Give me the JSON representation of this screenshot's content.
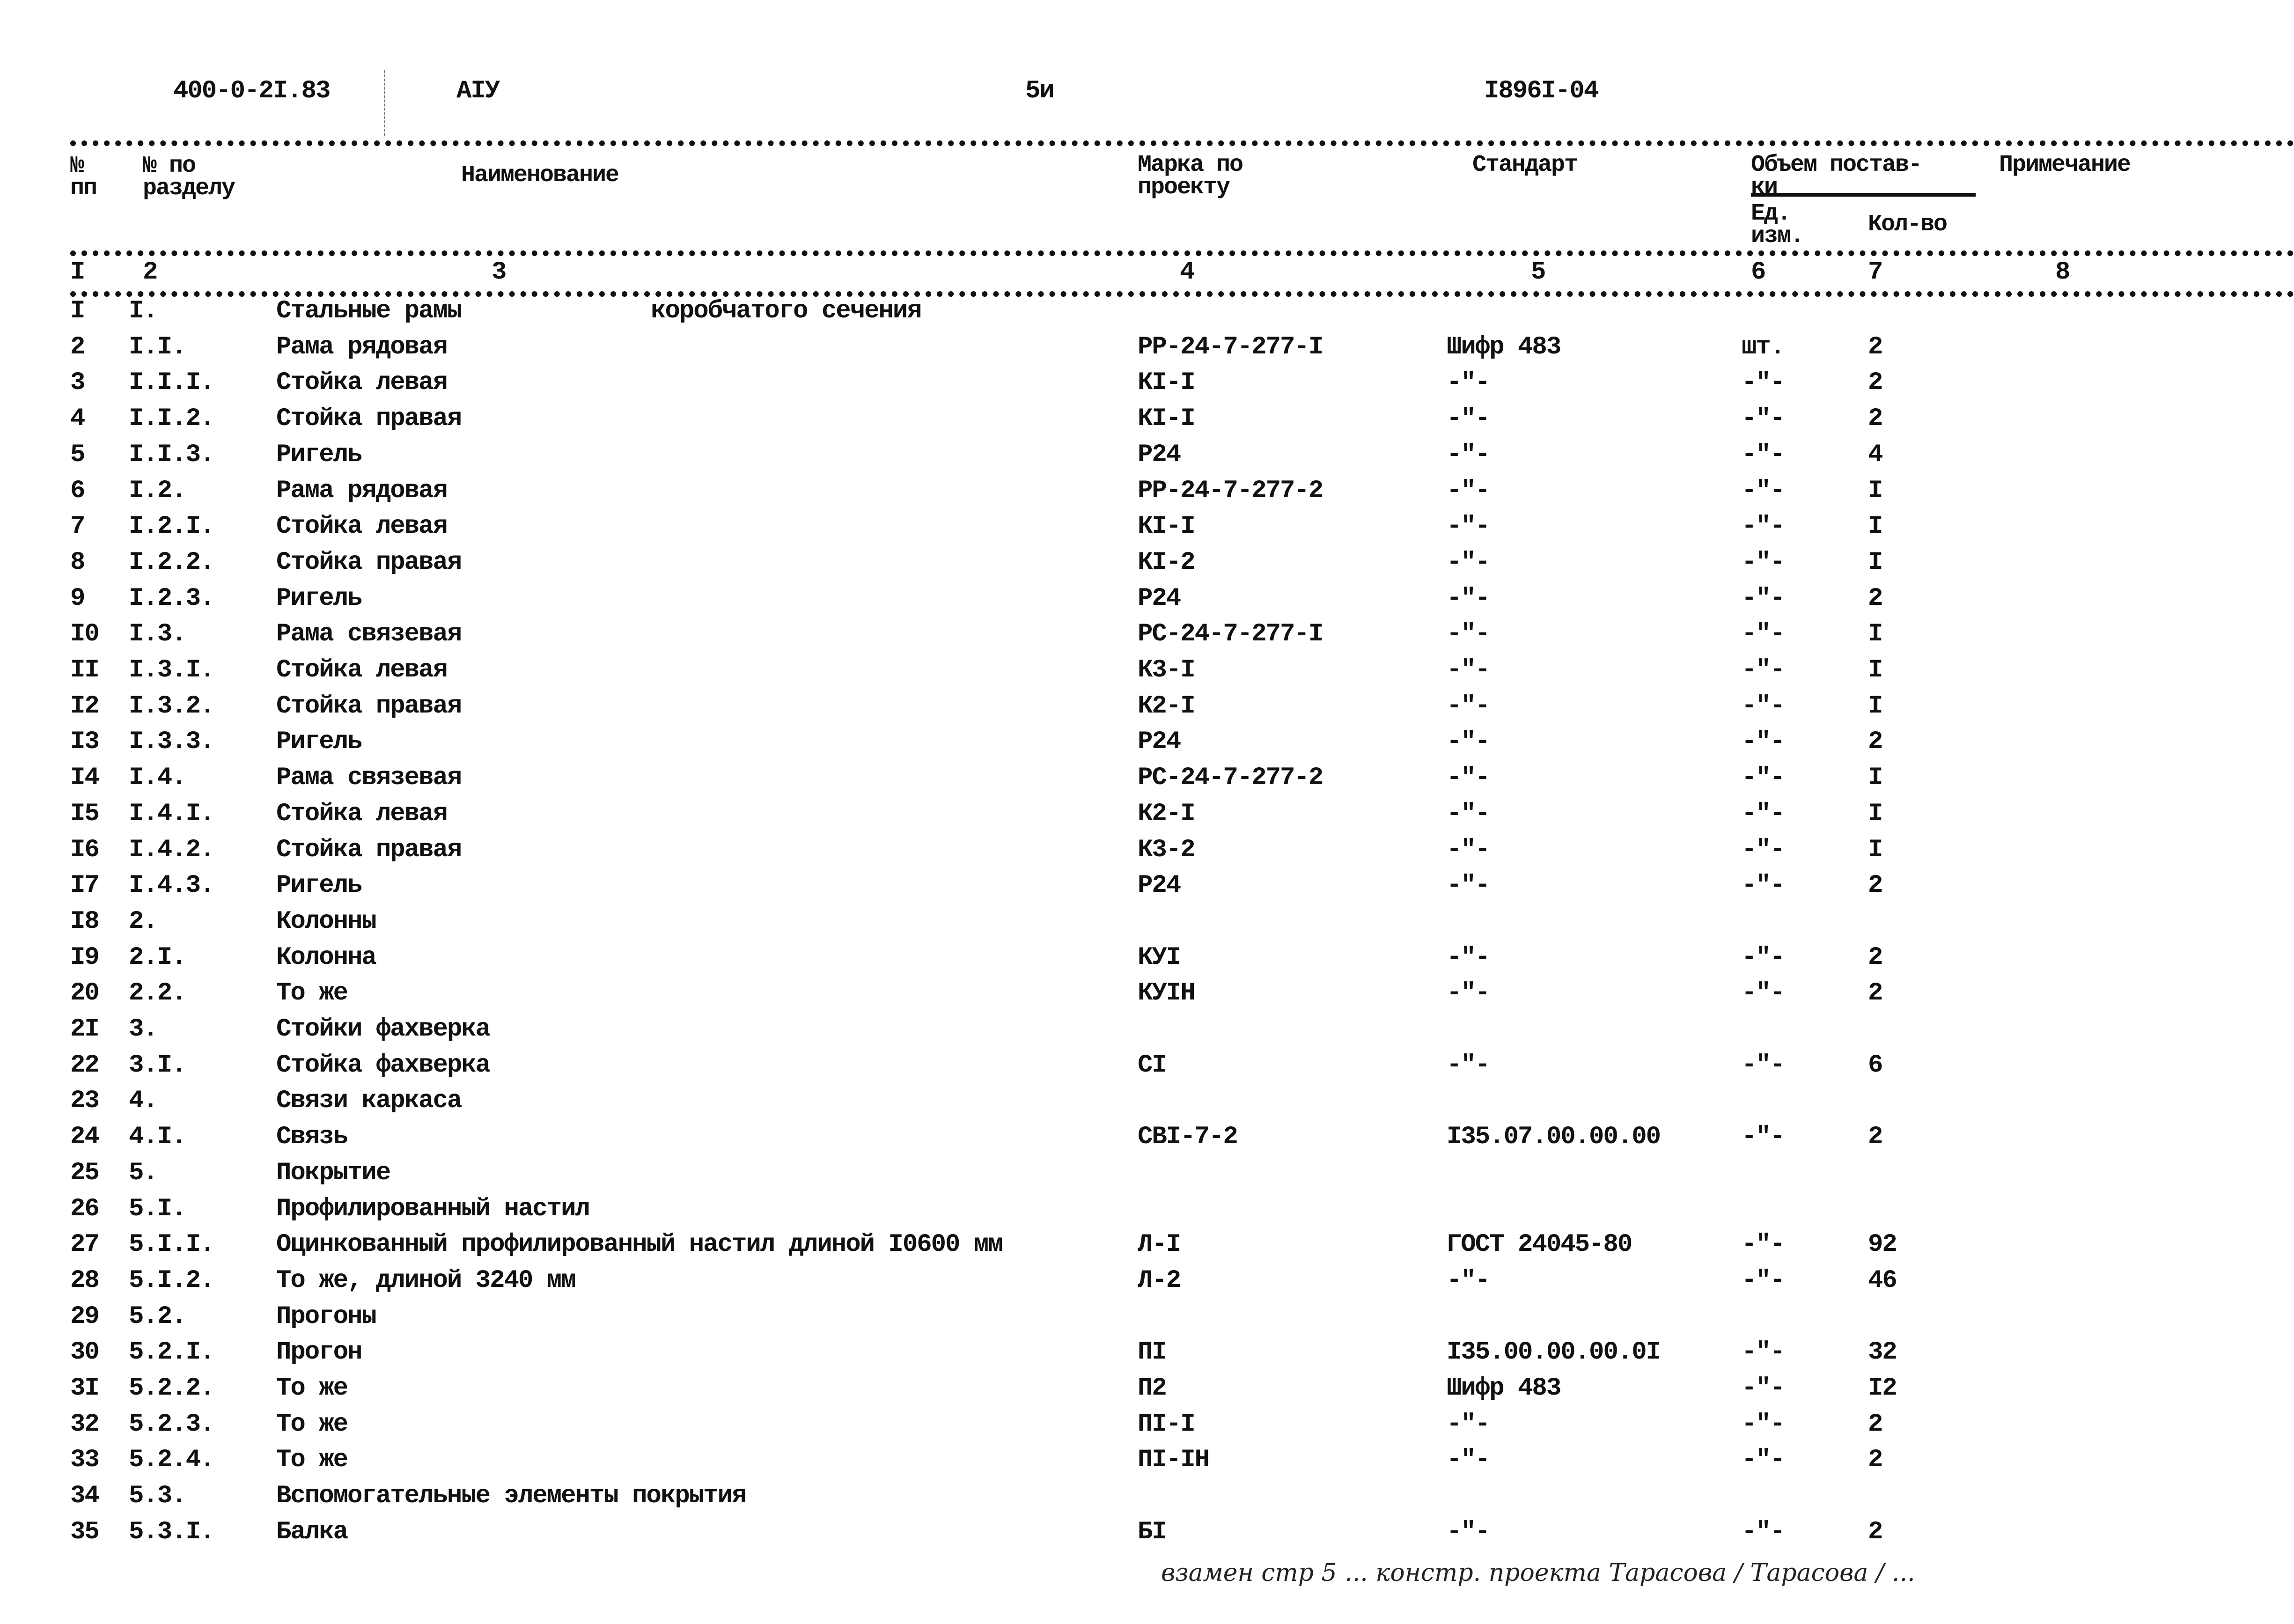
{
  "page_header": {
    "doc_code": "400-0-2I.83",
    "album": "AIУ",
    "page": "5и",
    "sheet_code": "I896I-04"
  },
  "table_header": {
    "col1": [
      "№",
      "пп"
    ],
    "col2": [
      "№ по",
      "разделу"
    ],
    "col3": "Наименование",
    "col4": [
      "Марка по",
      "проекту"
    ],
    "col5": "Стандарт",
    "col67_group": [
      "Объем постав-",
      "ки"
    ],
    "col6": [
      "Ед.",
      "изм."
    ],
    "col7": "Кол-во",
    "col8": "Примечание",
    "col_numbers": [
      "I",
      "2",
      "3",
      "4",
      "5",
      "6",
      "7",
      "8"
    ]
  },
  "rows": [
    {
      "n": "I",
      "sec": "I.",
      "name": "Стальные рамы",
      "name_extra": "коробчатого сечения",
      "mark": "",
      "std": "",
      "unit": "",
      "qty": ""
    },
    {
      "n": "2",
      "sec": "I.I.",
      "name": "Рама рядовая",
      "mark": "РР-24-7-277-I",
      "std": "Шифр 483",
      "unit": "шт.",
      "qty": "2"
    },
    {
      "n": "3",
      "sec": "I.I.I.",
      "name": "Стойка левая",
      "mark": "КI-I",
      "std": "-\"-",
      "unit": "-\"-",
      "qty": "2"
    },
    {
      "n": "4",
      "sec": "I.I.2.",
      "name": "Стойка правая",
      "mark": "КI-I",
      "std": "-\"-",
      "unit": "-\"-",
      "qty": "2"
    },
    {
      "n": "5",
      "sec": "I.I.3.",
      "name": "Ригель",
      "mark": "Р24",
      "std": "-\"-",
      "unit": "-\"-",
      "qty": "4"
    },
    {
      "n": "6",
      "sec": "I.2.",
      "name": "Рама рядовая",
      "mark": "РР-24-7-277-2",
      "std": "-\"-",
      "unit": "-\"-",
      "qty": "I"
    },
    {
      "n": "7",
      "sec": "I.2.I.",
      "name": "Стойка левая",
      "mark": "КI-I",
      "std": "-\"-",
      "unit": "-\"-",
      "qty": "I"
    },
    {
      "n": "8",
      "sec": "I.2.2.",
      "name": "Стойка правая",
      "mark": "КI-2",
      "std": "-\"-",
      "unit": "-\"-",
      "qty": "I"
    },
    {
      "n": "9",
      "sec": "I.2.3.",
      "name": "Ригель",
      "mark": "Р24",
      "std": "-\"-",
      "unit": "-\"-",
      "qty": "2"
    },
    {
      "n": "I0",
      "sec": "I.3.",
      "name": "Рама связевая",
      "mark": "РС-24-7-277-I",
      "std": "-\"-",
      "unit": "-\"-",
      "qty": "I"
    },
    {
      "n": "II",
      "sec": "I.3.I.",
      "name": "Стойка левая",
      "mark": "К3-I",
      "std": "-\"-",
      "unit": "-\"-",
      "qty": "I"
    },
    {
      "n": "I2",
      "sec": "I.3.2.",
      "name": "Стойка правая",
      "mark": "К2-I",
      "std": "-\"-",
      "unit": "-\"-",
      "qty": "I"
    },
    {
      "n": "I3",
      "sec": "I.3.3.",
      "name": "Ригель",
      "mark": "Р24",
      "std": "-\"-",
      "unit": "-\"-",
      "qty": "2"
    },
    {
      "n": "I4",
      "sec": "I.4.",
      "name": "Рама связевая",
      "mark": "РС-24-7-277-2",
      "std": "-\"-",
      "unit": "-\"-",
      "qty": "I"
    },
    {
      "n": "I5",
      "sec": "I.4.I.",
      "name": "Стойка левая",
      "mark": "К2-I",
      "std": "-\"-",
      "unit": "-\"-",
      "qty": "I"
    },
    {
      "n": "I6",
      "sec": "I.4.2.",
      "name": "Стойка правая",
      "mark": "К3-2",
      "std": "-\"-",
      "unit": "-\"-",
      "qty": "I"
    },
    {
      "n": "I7",
      "sec": "I.4.3.",
      "name": "Ригель",
      "mark": "Р24",
      "std": "-\"-",
      "unit": "-\"-",
      "qty": "2"
    },
    {
      "n": "I8",
      "sec": "2.",
      "name": "Колонны",
      "mark": "",
      "std": "",
      "unit": "",
      "qty": ""
    },
    {
      "n": "I9",
      "sec": "2.I.",
      "name": "Колонна",
      "mark": "КУI",
      "std": "-\"-",
      "unit": "-\"-",
      "qty": "2"
    },
    {
      "n": "20",
      "sec": "2.2.",
      "name": "То же",
      "mark": "КУIН",
      "std": "-\"-",
      "unit": "-\"-",
      "qty": "2"
    },
    {
      "n": "2I",
      "sec": "3.",
      "name": "Стойки фахверка",
      "mark": "",
      "std": "",
      "unit": "",
      "qty": ""
    },
    {
      "n": "22",
      "sec": "3.I.",
      "name": "Стойка фахверка",
      "mark": "СI",
      "std": "-\"-",
      "unit": "-\"-",
      "qty": "6"
    },
    {
      "n": "23",
      "sec": "4.",
      "name": "Связи каркаса",
      "mark": "",
      "std": "",
      "unit": "",
      "qty": ""
    },
    {
      "n": "24",
      "sec": "4.I.",
      "name": "Связь",
      "mark": "СВI-7-2",
      "std": "I35.07.00.00.00",
      "unit": "-\"-",
      "qty": "2"
    },
    {
      "n": "25",
      "sec": "5.",
      "name": "Покрытие",
      "mark": "",
      "std": "",
      "unit": "",
      "qty": ""
    },
    {
      "n": "26",
      "sec": "5.I.",
      "name": "Профилированный настил",
      "mark": "",
      "std": "",
      "unit": "",
      "qty": ""
    },
    {
      "n": "27",
      "sec": "5.I.I.",
      "name": "Оцинкованный профилированный настил длиной I0600 мм",
      "mark": "Л-I",
      "std": "ГОСТ 24045-80",
      "unit": "-\"-",
      "qty": "92"
    },
    {
      "n": "28",
      "sec": "5.I.2.",
      "name": "То же, длиной 3240 мм",
      "mark": "Л-2",
      "std": "-\"-",
      "unit": "-\"-",
      "qty": "46"
    },
    {
      "n": "29",
      "sec": "5.2.",
      "name": "Прогоны",
      "mark": "",
      "std": "",
      "unit": "",
      "qty": ""
    },
    {
      "n": "30",
      "sec": "5.2.I.",
      "name": "Прогон",
      "mark": "ПI",
      "std": "I35.00.00.00.0I",
      "unit": "-\"-",
      "qty": "32"
    },
    {
      "n": "3I",
      "sec": "5.2.2.",
      "name": "То же",
      "mark": "П2",
      "std": "Шифр 483",
      "unit": "-\"-",
      "qty": "I2"
    },
    {
      "n": "32",
      "sec": "5.2.3.",
      "name": "То же",
      "mark": "ПI-I",
      "std": "-\"-",
      "unit": "-\"-",
      "qty": "2"
    },
    {
      "n": "33",
      "sec": "5.2.4.",
      "name": "То же",
      "mark": "ПI-IН",
      "std": "-\"-",
      "unit": "-\"-",
      "qty": "2"
    },
    {
      "n": "34",
      "sec": "5.3.",
      "name": "Вспомогательные элементы покрытия",
      "mark": "",
      "std": "",
      "unit": "",
      "qty": ""
    },
    {
      "n": "35",
      "sec": "5.3.I.",
      "name": "Балка",
      "mark": "БI",
      "std": "-\"-",
      "unit": "-\"-",
      "qty": "2"
    }
  ],
  "handwritten_note": "взамен стр 5 ... констр. проекта Тарасова / Тарасова / ..."
}
